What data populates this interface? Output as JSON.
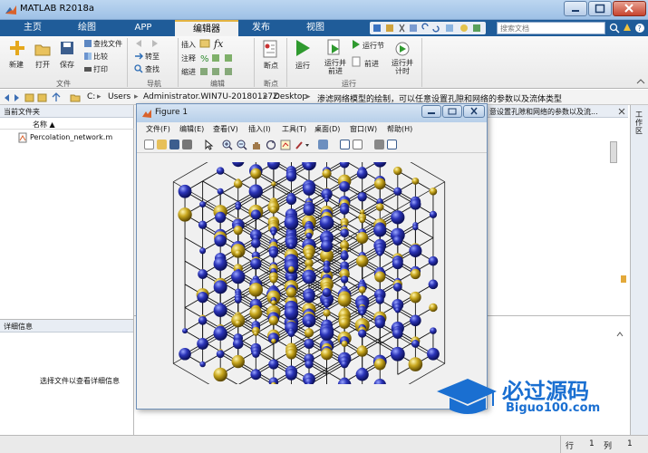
{
  "window": {
    "title": "MATLAB R2018a"
  },
  "tabs": [
    "主页",
    "绘图",
    "APP",
    "编辑器",
    "发布",
    "视图"
  ],
  "search": {
    "placeholder": "搜索文档"
  },
  "ribbon": {
    "file": {
      "new": "新建",
      "open": "打开",
      "save": "保存",
      "find_files": "查找文件",
      "compare": "比较",
      "print": "打印",
      "group": "文件"
    },
    "navigate": {
      "goto": "转至",
      "find": "查找",
      "group": "导航"
    },
    "edit": {
      "insert": "插入",
      "comment": "注释",
      "indent": "缩进",
      "fx": "fx",
      "group": "编辑"
    },
    "breakpoints": {
      "label": "断点",
      "group": "断点"
    },
    "run": {
      "run": "运行",
      "run_advance": "运行并\n前进",
      "run_section": "运行节",
      "advance": "前进",
      "run_time": "运行并\n计时",
      "group": "运行"
    }
  },
  "address": {
    "parts": [
      "C:",
      "Users",
      "Administrator.WIN7U-20180127Z",
      "Desktop",
      "渗滤网络模型的绘制，可以任意设置孔隙和网络的参数以及流体类型"
    ]
  },
  "current_folder": {
    "title": "当前文件夹",
    "col_name": "名称 ▲",
    "files": [
      "Percolation_network.m"
    ]
  },
  "details": {
    "title": "详细信息",
    "hint": "选择文件以查看详细信息"
  },
  "editor_tab": {
    "text": "意设置孔隙和网络的参数以及流..."
  },
  "workspace": {
    "label": "工作区"
  },
  "figure": {
    "title": "Figure 1",
    "menu": [
      "文件(F)",
      "编辑(E)",
      "查看(V)",
      "插入(I)",
      "工具(T)",
      "桌面(D)",
      "窗口(W)",
      "帮助(H)"
    ]
  },
  "status": {
    "row_label": "行",
    "row": "1",
    "col_label": "列",
    "col": "1"
  },
  "watermark": {
    "name": "必过源码",
    "url": "Biguo100.com"
  },
  "colors": {
    "tabbar": "#1f5c99",
    "pore_blue": "#2b34b8",
    "pore_yellow": "#c9a81f",
    "watermark": "#1a6fd1"
  }
}
